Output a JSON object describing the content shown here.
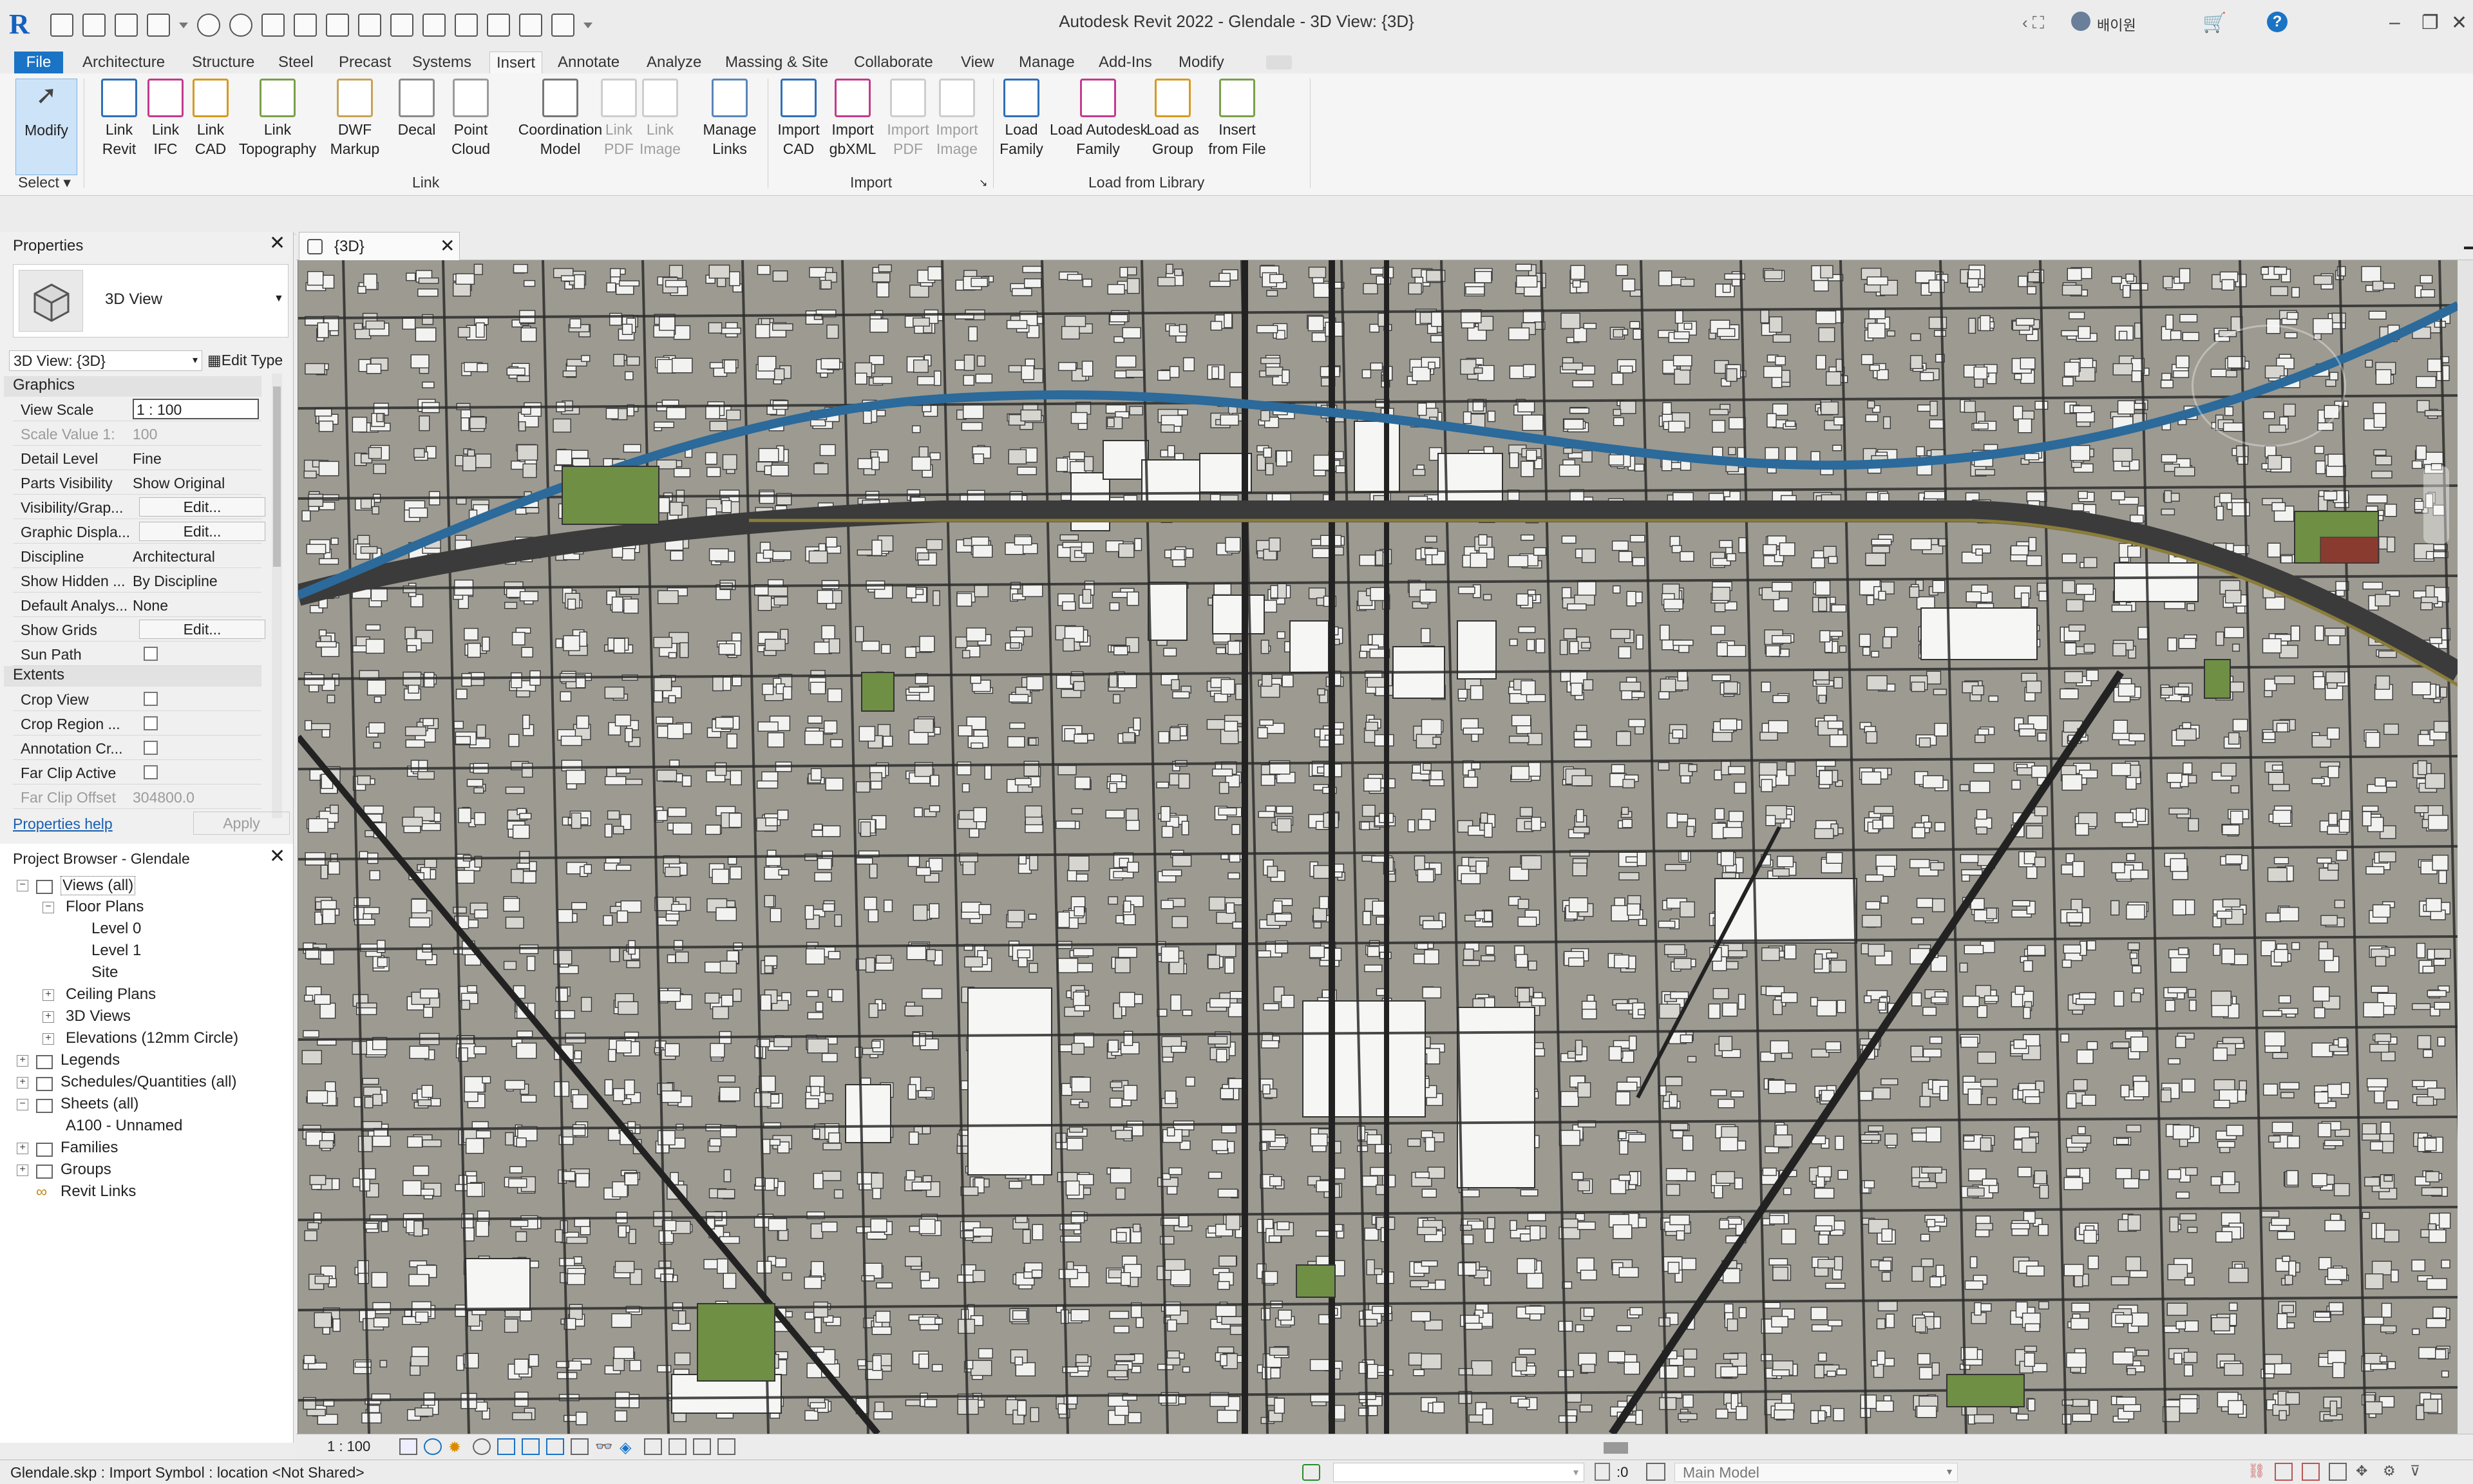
{
  "window": {
    "title": "Autodesk Revit 2022 - Glendale - 3D View: {3D}",
    "user": "배이원"
  },
  "tabs": [
    "File",
    "Architecture",
    "Structure",
    "Steel",
    "Precast",
    "Systems",
    "Insert",
    "Annotate",
    "Analyze",
    "Massing & Site",
    "Collaborate",
    "View",
    "Manage",
    "Add-Ins",
    "Modify"
  ],
  "ribbon": {
    "select": {
      "modify": "Modify",
      "label": "Select"
    },
    "link": {
      "label": "Link",
      "buttons": [
        [
          "Link",
          "Revit"
        ],
        [
          "Link",
          "IFC"
        ],
        [
          "Link",
          "CAD"
        ],
        [
          "Link",
          "Topography"
        ],
        [
          "DWF",
          "Markup"
        ],
        [
          "Decal",
          ""
        ],
        [
          "Point",
          "Cloud"
        ],
        [
          "Coordination",
          "Model"
        ],
        [
          "Link",
          "PDF"
        ],
        [
          "Link",
          "Image"
        ],
        [
          "Manage",
          "Links"
        ]
      ]
    },
    "import": {
      "label": "Import",
      "buttons": [
        [
          "Import",
          "CAD"
        ],
        [
          "Import",
          "gbXML"
        ],
        [
          "Import",
          "PDF"
        ],
        [
          "Import",
          "Image"
        ]
      ]
    },
    "library": {
      "label": "Load from Library",
      "buttons": [
        [
          "Load",
          "Family"
        ],
        [
          "Load Autodesk",
          "Family"
        ],
        [
          "Load as",
          "Group"
        ],
        [
          "Insert",
          "from File"
        ]
      ]
    }
  },
  "properties": {
    "title": "Properties",
    "type_name": "3D View",
    "selector": "3D View: {3D}",
    "edit_type": "Edit Type",
    "graphics": "Graphics",
    "extents": "Extents",
    "rows": [
      {
        "k": "View Scale",
        "v": "1 : 100"
      },
      {
        "k": "Scale Value    1:",
        "v": "100"
      },
      {
        "k": "Detail Level",
        "v": "Fine"
      },
      {
        "k": "Parts Visibility",
        "v": "Show Original"
      },
      {
        "k": "Visibility/Grap...",
        "v": "Edit..."
      },
      {
        "k": "Graphic Displa...",
        "v": "Edit..."
      },
      {
        "k": "Discipline",
        "v": "Architectural"
      },
      {
        "k": "Show Hidden ...",
        "v": "By Discipline"
      },
      {
        "k": "Default Analys...",
        "v": "None"
      },
      {
        "k": "Show Grids",
        "v": "Edit..."
      },
      {
        "k": "Sun Path",
        "v": ""
      }
    ],
    "extent_rows": [
      {
        "k": "Crop View"
      },
      {
        "k": "Crop Region ..."
      },
      {
        "k": "Annotation Cr..."
      },
      {
        "k": "Far Clip Active"
      },
      {
        "k": "Far Clip Offset",
        "v": "304800.0"
      }
    ],
    "help": "Properties help",
    "apply": "Apply"
  },
  "browser": {
    "title": "Project Browser - Glendale",
    "nodes": [
      "Views (all)",
      "Floor Plans",
      "Level 0",
      "Level 1",
      "Site",
      "Ceiling Plans",
      "3D Views",
      "Elevations (12mm Circle)",
      "Legends",
      "Schedules/Quantities (all)",
      "Sheets (all)",
      "A100 - Unnamed",
      "Families",
      "Groups",
      "Revit Links"
    ]
  },
  "view": {
    "tab": "{3D}",
    "scale": "1 : 100"
  },
  "status": {
    "text": "Glendale.skp : Import Symbol : location <Not Shared>",
    "model": "Main Model",
    "zero": ":0"
  },
  "colors": {
    "accent": "#1a73c5",
    "ground": "#9d9a91",
    "road": "#2d2d2d",
    "river": "#2b6a9a",
    "rail": "#8a7d3a",
    "park": "#6f8f45"
  }
}
